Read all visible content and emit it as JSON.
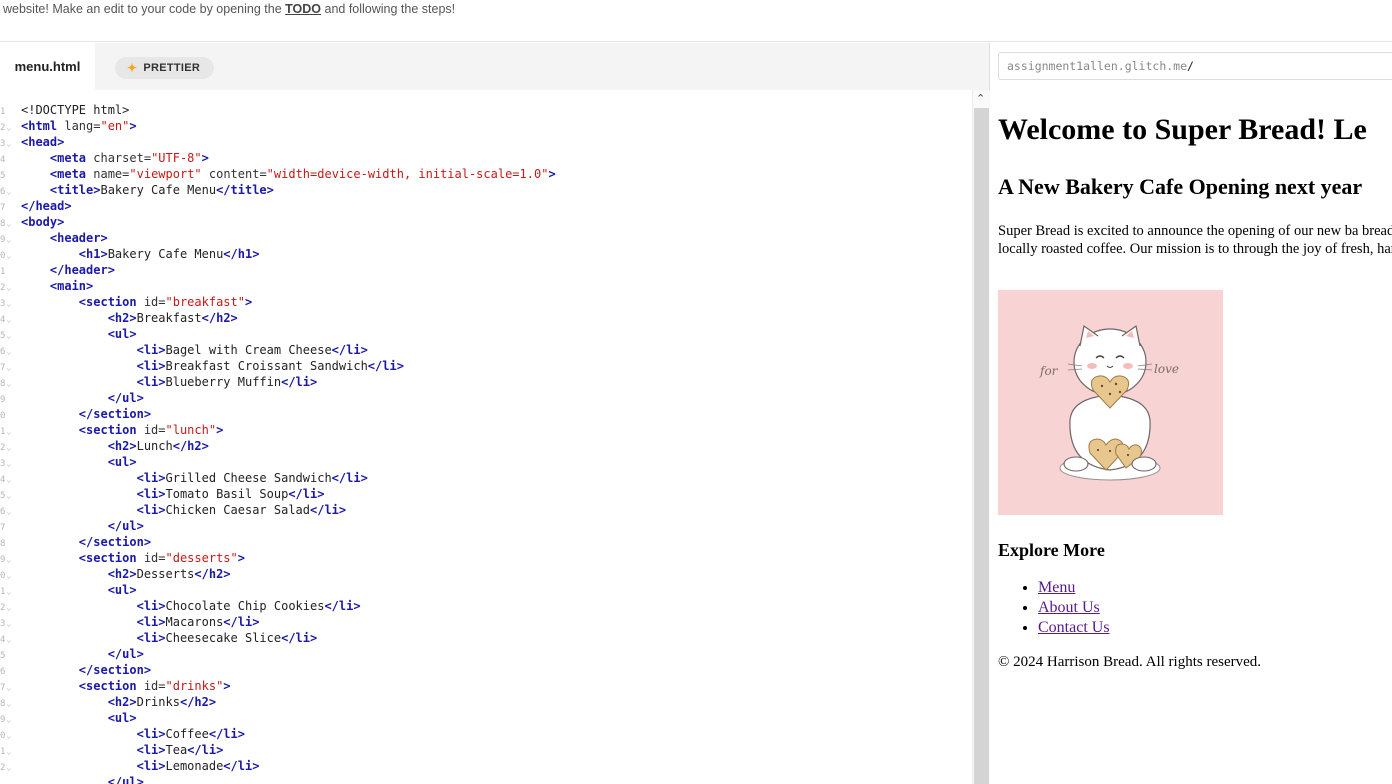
{
  "banner": {
    "text_before": "website! Make an edit to your code by opening the ",
    "todo_link": "TODO",
    "text_after": " and following the steps!"
  },
  "editor": {
    "file_tab": "menu.html",
    "prettier_label": "PRETTIER",
    "gutter": [
      "1",
      "2",
      "3",
      "4",
      "5",
      "6",
      "7",
      "8",
      "9",
      "0",
      "1",
      "2",
      "3",
      "4",
      "5",
      "6",
      "7",
      "8",
      "9",
      "0",
      "1",
      "2",
      "3",
      "4",
      "5",
      "6",
      "7",
      "8",
      "9",
      "0",
      "1",
      "2",
      "3",
      "4",
      "5",
      "6",
      "7",
      "8",
      "9",
      "0",
      "1",
      "2"
    ],
    "foldable_lines": [
      2,
      3,
      6,
      8,
      9,
      10,
      12,
      13,
      14,
      15,
      16,
      17,
      18,
      21,
      22,
      23,
      24,
      25,
      26,
      29,
      30,
      31,
      32,
      33,
      34,
      37,
      38,
      39,
      40,
      41,
      42
    ]
  },
  "code": [
    [
      [
        "txt",
        "<!DOCTYPE html>"
      ]
    ],
    [
      [
        "tag",
        "<html"
      ],
      [
        "attr",
        " lang="
      ],
      [
        "val",
        "\"en\""
      ],
      [
        "tag",
        ">"
      ]
    ],
    [
      [
        "tag",
        "<head>"
      ]
    ],
    [
      [
        "txt",
        "    "
      ],
      [
        "tag",
        "<meta"
      ],
      [
        "attr",
        " charset="
      ],
      [
        "val",
        "\"UTF-8\""
      ],
      [
        "tag",
        ">"
      ]
    ],
    [
      [
        "txt",
        "    "
      ],
      [
        "tag",
        "<meta"
      ],
      [
        "attr",
        " name="
      ],
      [
        "val",
        "\"viewport\""
      ],
      [
        "attr",
        " content="
      ],
      [
        "val",
        "\"width=device-width, initial-scale=1.0\""
      ],
      [
        "tag",
        ">"
      ]
    ],
    [
      [
        "txt",
        "    "
      ],
      [
        "tag",
        "<title>"
      ],
      [
        "txt",
        "Bakery Cafe Menu"
      ],
      [
        "tag",
        "</title>"
      ]
    ],
    [
      [
        "tag",
        "</head>"
      ]
    ],
    [
      [
        "tag",
        "<body>"
      ]
    ],
    [
      [
        "txt",
        "    "
      ],
      [
        "tag",
        "<header>"
      ]
    ],
    [
      [
        "txt",
        "        "
      ],
      [
        "tag",
        "<h1>"
      ],
      [
        "txt",
        "Bakery Cafe Menu"
      ],
      [
        "tag",
        "</h1>"
      ]
    ],
    [
      [
        "txt",
        "    "
      ],
      [
        "tag",
        "</header>"
      ]
    ],
    [
      [
        "txt",
        "    "
      ],
      [
        "tag",
        "<main>"
      ]
    ],
    [
      [
        "txt",
        "        "
      ],
      [
        "tag",
        "<section"
      ],
      [
        "attr",
        " id="
      ],
      [
        "val",
        "\"breakfast\""
      ],
      [
        "tag",
        ">"
      ]
    ],
    [
      [
        "txt",
        "            "
      ],
      [
        "tag",
        "<h2>"
      ],
      [
        "txt",
        "Breakfast"
      ],
      [
        "tag",
        "</h2>"
      ]
    ],
    [
      [
        "txt",
        "            "
      ],
      [
        "tag",
        "<ul>"
      ]
    ],
    [
      [
        "txt",
        "                "
      ],
      [
        "tag",
        "<li>"
      ],
      [
        "txt",
        "Bagel with Cream Cheese"
      ],
      [
        "tag",
        "</li>"
      ]
    ],
    [
      [
        "txt",
        "                "
      ],
      [
        "tag",
        "<li>"
      ],
      [
        "txt",
        "Breakfast Croissant Sandwich"
      ],
      [
        "tag",
        "</li>"
      ]
    ],
    [
      [
        "txt",
        "                "
      ],
      [
        "tag",
        "<li>"
      ],
      [
        "txt",
        "Blueberry Muffin"
      ],
      [
        "tag",
        "</li>"
      ]
    ],
    [
      [
        "txt",
        "            "
      ],
      [
        "tag",
        "</ul>"
      ]
    ],
    [
      [
        "txt",
        "        "
      ],
      [
        "tag",
        "</section>"
      ]
    ],
    [
      [
        "txt",
        "        "
      ],
      [
        "tag",
        "<section"
      ],
      [
        "attr",
        " id="
      ],
      [
        "val",
        "\"lunch\""
      ],
      [
        "tag",
        ">"
      ]
    ],
    [
      [
        "txt",
        "            "
      ],
      [
        "tag",
        "<h2>"
      ],
      [
        "txt",
        "Lunch"
      ],
      [
        "tag",
        "</h2>"
      ]
    ],
    [
      [
        "txt",
        "            "
      ],
      [
        "tag",
        "<ul>"
      ]
    ],
    [
      [
        "txt",
        "                "
      ],
      [
        "tag",
        "<li>"
      ],
      [
        "txt",
        "Grilled Cheese Sandwich"
      ],
      [
        "tag",
        "</li>"
      ]
    ],
    [
      [
        "txt",
        "                "
      ],
      [
        "tag",
        "<li>"
      ],
      [
        "txt",
        "Tomato Basil Soup"
      ],
      [
        "tag",
        "</li>"
      ]
    ],
    [
      [
        "txt",
        "                "
      ],
      [
        "tag",
        "<li>"
      ],
      [
        "txt",
        "Chicken Caesar Salad"
      ],
      [
        "tag",
        "</li>"
      ]
    ],
    [
      [
        "txt",
        "            "
      ],
      [
        "tag",
        "</ul>"
      ]
    ],
    [
      [
        "txt",
        "        "
      ],
      [
        "tag",
        "</section>"
      ]
    ],
    [
      [
        "txt",
        "        "
      ],
      [
        "tag",
        "<section"
      ],
      [
        "attr",
        " id="
      ],
      [
        "val",
        "\"desserts\""
      ],
      [
        "tag",
        ">"
      ]
    ],
    [
      [
        "txt",
        "            "
      ],
      [
        "tag",
        "<h2>"
      ],
      [
        "txt",
        "Desserts"
      ],
      [
        "tag",
        "</h2>"
      ]
    ],
    [
      [
        "txt",
        "            "
      ],
      [
        "tag",
        "<ul>"
      ]
    ],
    [
      [
        "txt",
        "                "
      ],
      [
        "tag",
        "<li>"
      ],
      [
        "txt",
        "Chocolate Chip Cookies"
      ],
      [
        "tag",
        "</li>"
      ]
    ],
    [
      [
        "txt",
        "                "
      ],
      [
        "tag",
        "<li>"
      ],
      [
        "txt",
        "Macarons"
      ],
      [
        "tag",
        "</li>"
      ]
    ],
    [
      [
        "txt",
        "                "
      ],
      [
        "tag",
        "<li>"
      ],
      [
        "txt",
        "Cheesecake Slice"
      ],
      [
        "tag",
        "</li>"
      ]
    ],
    [
      [
        "txt",
        "            "
      ],
      [
        "tag",
        "</ul>"
      ]
    ],
    [
      [
        "txt",
        "        "
      ],
      [
        "tag",
        "</section>"
      ]
    ],
    [
      [
        "txt",
        "        "
      ],
      [
        "tag",
        "<section"
      ],
      [
        "attr",
        " id="
      ],
      [
        "val",
        "\"drinks\""
      ],
      [
        "tag",
        ">"
      ]
    ],
    [
      [
        "txt",
        "            "
      ],
      [
        "tag",
        "<h2>"
      ],
      [
        "txt",
        "Drinks"
      ],
      [
        "tag",
        "</h2>"
      ]
    ],
    [
      [
        "txt",
        "            "
      ],
      [
        "tag",
        "<ul>"
      ]
    ],
    [
      [
        "txt",
        "                "
      ],
      [
        "tag",
        "<li>"
      ],
      [
        "txt",
        "Coffee"
      ],
      [
        "tag",
        "</li>"
      ]
    ],
    [
      [
        "txt",
        "                "
      ],
      [
        "tag",
        "<li>"
      ],
      [
        "txt",
        "Tea"
      ],
      [
        "tag",
        "</li>"
      ]
    ],
    [
      [
        "txt",
        "                "
      ],
      [
        "tag",
        "<li>"
      ],
      [
        "txt",
        "Lemonade"
      ],
      [
        "tag",
        "</li>"
      ]
    ],
    [
      [
        "txt",
        "            "
      ],
      [
        "tag",
        "</ul>"
      ]
    ]
  ],
  "preview": {
    "url_host": "assignment1allen.glitch.me",
    "url_path": "/",
    "heading": "Welcome to Super Bread! Le",
    "subheading": "A New Bakery Cafe Opening next year",
    "paragraph": "Super Bread is excited to announce the opening of our new ba breads, pastries, and locally roasted coffee. Our mission is to through the joy of fresh, handmade baked goods.",
    "image_text_left": "for",
    "image_text_right": "love",
    "explore_heading": "Explore More",
    "links": [
      "Menu",
      "About Us",
      "Contact Us"
    ],
    "footer": "© 2024 Harrison Bread. All rights reserved."
  },
  "colors": {
    "tag": "#1a1aa6",
    "attr_value": "#c41a16",
    "link_visited": "#551a8b",
    "image_background": "#f8d3d3"
  }
}
